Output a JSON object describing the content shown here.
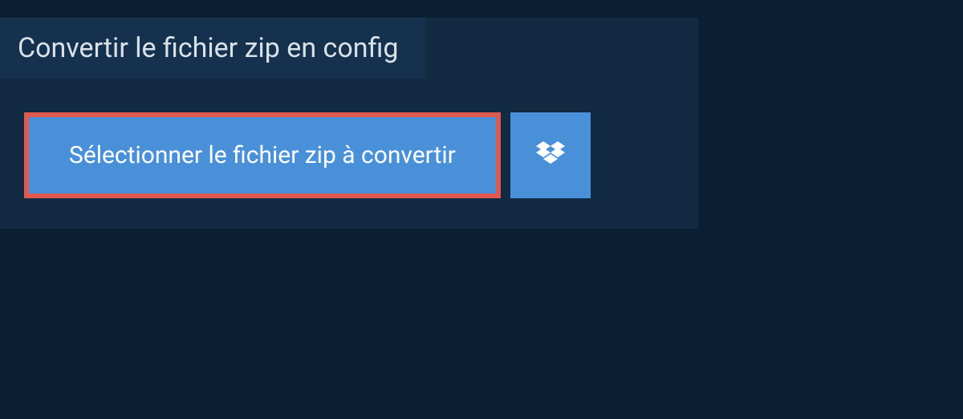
{
  "tab": {
    "title": "Convertir le fichier zip en config"
  },
  "actions": {
    "select_file_label": "Sélectionner le fichier zip à convertir"
  }
}
